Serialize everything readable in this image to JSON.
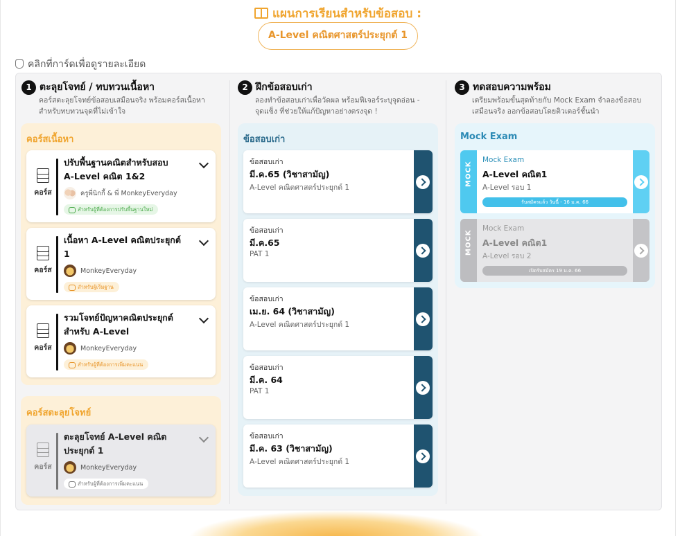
{
  "header": {
    "title": "แผนการเรียนสำหรับข้อสอบ :",
    "subject": "A-Level คณิตศาสตร์ประยุกต์ 1",
    "hint": "คลิกที่การ์ดเพื่อดูรายละเอียด"
  },
  "steps": [
    {
      "num": "1",
      "title": "ตะลุยโจทย์ / ทบทวนเนื้อหา",
      "desc1": "คอร์สตะลุยโจทย์ข้อสอบเสมือนจริง พร้อมคอร์สเนื้อหา",
      "desc2": "สำหรับทบทวนจุดที่ไม่เข้าใจ"
    },
    {
      "num": "2",
      "title": "ฝึกข้อสอบเก่า",
      "desc1": "ลองทำข้อสอบเก่าเพื่อวัดผล พร้อมฟีเจอร์ระบุจุดอ่อน -",
      "desc2": "จุดแข็ง ที่ช่วยให้แก้ปัญหาอย่างตรงจุด !"
    },
    {
      "num": "3",
      "title": "ทดสอบความพร้อม",
      "desc1": "เตรียมพร้อมขั้นสุดท้ายกับ Mock Exam จำลองข้อสอบ",
      "desc2": "เสมือนจริง ออกข้อสอบโดยติวเตอร์ชั้นนำ"
    }
  ],
  "content_courses": {
    "title": "คอร์สเนื้อหา",
    "items": [
      {
        "title1": "ปรับพื้นฐานคณิตสำหรับสอบ",
        "title2": "A-Level คณิต 1&2",
        "teacher": "ครูพี่นิกกี้ & พี่ MonkeyEveryday",
        "tag": "สำหรับผู้ที่ต้องการปรับพื้นฐานใหม่",
        "label": "คอร์ส"
      },
      {
        "title1": "เนื้อหา A-Level คณิตประยุกต์",
        "title2": "1",
        "teacher": "MonkeyEveryday",
        "tag": "สำหรับผู้เริ่มฐาน",
        "label": "คอร์ส"
      },
      {
        "title1": "รวมโจทย์ปัญหาคณิตประยุกต์",
        "title2": "สำหรับ A-Level",
        "teacher": "MonkeyEveryday",
        "tag": "สำหรับผู้ที่ต้องการเพิ่มคะแนน",
        "label": "คอร์ส"
      }
    ]
  },
  "practice_courses": {
    "title": "คอร์สตะลุยโจทย์",
    "items": [
      {
        "title1": "ตะลุยโจทย์ A-Level คณิต",
        "title2": "ประยุกต์ 1",
        "teacher": "MonkeyEveryday",
        "tag": "สำหรับผู้ที่ต้องการเพิ่มคะแนน",
        "label": "คอร์ส"
      }
    ]
  },
  "old_exams": {
    "title": "ข้อสอบเก่า",
    "items": [
      {
        "type": "ข้อสอบเก่า",
        "date": "มี.ค.65 (วิชาสามัญ)",
        "subject": "A-Level คณิตศาสตร์ประยุกต์ 1"
      },
      {
        "type": "ข้อสอบเก่า",
        "date": "มี.ค.65",
        "subject": "PAT 1"
      },
      {
        "type": "ข้อสอบเก่า",
        "date": "เม.ย. 64 (วิชาสามัญ)",
        "subject": "A-Level คณิตศาสตร์ประยุกต์ 1"
      },
      {
        "type": "ข้อสอบเก่า",
        "date": "มี.ค. 64",
        "subject": "PAT 1"
      },
      {
        "type": "ข้อสอบเก่า",
        "date": "มี.ค. 63 (วิชาสามัญ)",
        "subject": "A-Level คณิตศาสตร์ประยุกต์ 1"
      }
    ]
  },
  "mock_exams": {
    "title": "Mock Exam",
    "items": [
      {
        "vertical": "MOCK",
        "type": "Mock Exam",
        "title": "A-Level คณิต1",
        "round": "A-Level รอบ 1",
        "badge": "รับสมัครแล้ว วันนี้ - 16 ม.ค. 66"
      },
      {
        "vertical": "MOCK",
        "type": "Mock Exam",
        "title": "A-Level คณิต1",
        "round": "A-Level รอบ 2",
        "badge": "เปิดรับสมัคร 19 ม.ค. 66"
      }
    ]
  },
  "colors": {
    "accent_orange": "#f0a52f",
    "exam_dark": "#1f5370",
    "mock_blue": "#4fc9ef"
  }
}
